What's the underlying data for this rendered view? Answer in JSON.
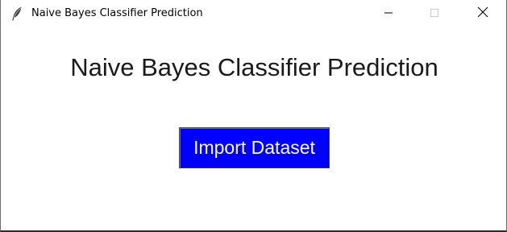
{
  "window": {
    "title": "Naive Bayes Classifier Prediction",
    "icon": "feather-icon",
    "controls": {
      "minimize_icon": "minimize-icon",
      "maximize_icon": "maximize-icon",
      "close_icon": "close-icon"
    }
  },
  "main": {
    "heading": "Naive Bayes Classifier Prediction",
    "import_button_label": "Import Dataset"
  },
  "colors": {
    "button_background": "#0000ff",
    "button_text": "#ffffff",
    "background": "#ffffff"
  }
}
